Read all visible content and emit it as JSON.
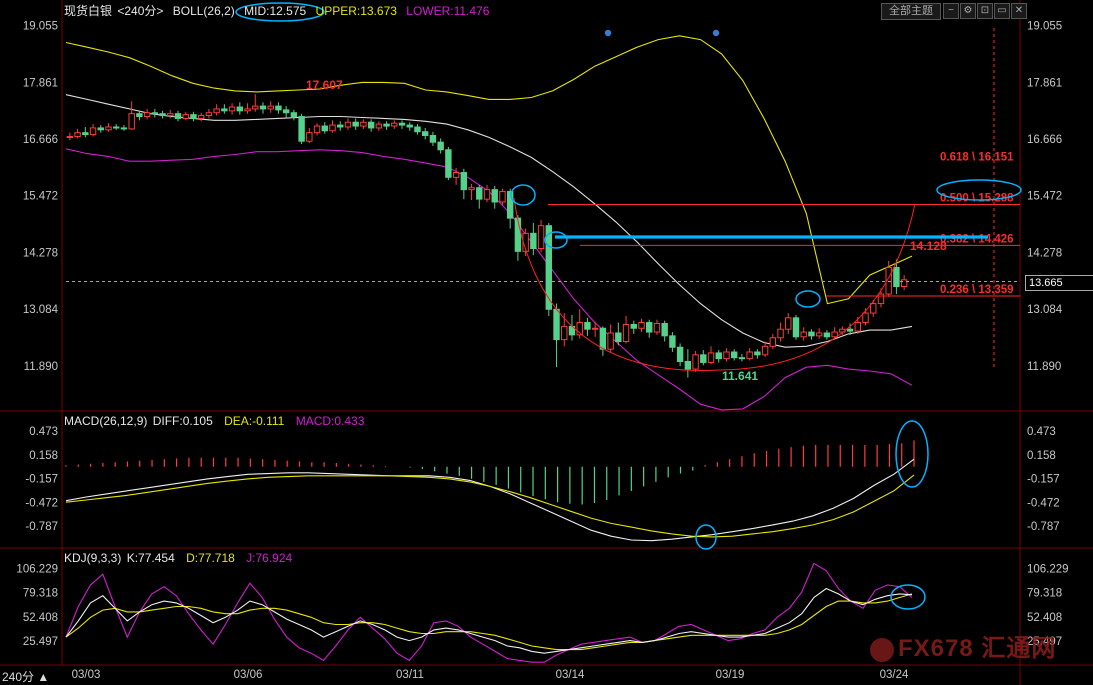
{
  "header": {
    "title": "现货白银",
    "period": "<240分>",
    "boll_label": "BOLL(26,2)",
    "mid": "MID:12.575",
    "upper": "UPPER:13.673",
    "lower": "LOWER:11.476",
    "theme_button": "全部主题",
    "period_tag": "240分 ▲"
  },
  "macd_header": {
    "label": "MACD(26,12,9)",
    "diff": "DIFF:0.105",
    "dea": "DEA:-0.111",
    "macd": "MACD:0.433"
  },
  "kdj_header": {
    "label": "KDJ(9,3,3)",
    "k": "K:77.454",
    "d": "D:77.718",
    "j": "J:76.924"
  },
  "watermark": "FX678 汇通网",
  "current_price": "13.665",
  "colors": {
    "up": "#ff3b3b",
    "down": "#54d28b",
    "mid": "#e0e0e0",
    "upper": "#e6e600",
    "lower": "#d21ed2",
    "annotation": "#00b4ff",
    "fib": "#ff2a2a"
  },
  "chart_data": [
    {
      "type": "candlestick",
      "name": "price",
      "y_ticks": [
        19.055,
        17.861,
        16.666,
        15.472,
        14.278,
        13.084,
        11.89
      ],
      "ylim": [
        11.0,
        19.3
      ],
      "x_ticks": [
        "03/03",
        "03/06",
        "03/11",
        "03/14",
        "03/19",
        "03/24"
      ],
      "candles": [
        [
          16.7,
          16.72,
          16.8,
          16.64
        ],
        [
          16.72,
          16.8,
          16.88,
          16.68
        ],
        [
          16.8,
          16.76,
          16.92,
          16.7
        ],
        [
          16.76,
          16.9,
          16.98,
          16.72
        ],
        [
          16.9,
          16.86,
          16.96,
          16.8
        ],
        [
          16.86,
          16.92,
          17.0,
          16.82
        ],
        [
          16.92,
          16.9,
          16.98,
          16.86
        ],
        [
          16.9,
          16.88,
          16.96,
          16.84
        ],
        [
          16.88,
          17.2,
          17.46,
          16.86
        ],
        [
          17.2,
          17.14,
          17.26,
          17.06
        ],
        [
          17.14,
          17.22,
          17.3,
          17.08
        ],
        [
          17.22,
          17.2,
          17.3,
          17.12
        ],
        [
          17.2,
          17.16,
          17.26,
          17.1
        ],
        [
          17.16,
          17.2,
          17.28,
          17.1
        ],
        [
          17.2,
          17.1,
          17.26,
          17.04
        ],
        [
          17.1,
          17.18,
          17.24,
          17.06
        ],
        [
          17.18,
          17.1,
          17.24,
          17.04
        ],
        [
          17.1,
          17.16,
          17.22,
          17.04
        ],
        [
          17.16,
          17.22,
          17.3,
          17.1
        ],
        [
          17.22,
          17.3,
          17.4,
          17.16
        ],
        [
          17.3,
          17.26,
          17.4,
          17.2
        ],
        [
          17.26,
          17.34,
          17.42,
          17.18
        ],
        [
          17.34,
          17.26,
          17.44,
          17.18
        ],
        [
          17.26,
          17.3,
          17.42,
          17.2
        ],
        [
          17.3,
          17.36,
          17.61,
          17.24
        ],
        [
          17.36,
          17.3,
          17.44,
          17.2
        ],
        [
          17.3,
          17.36,
          17.46,
          17.22
        ],
        [
          17.36,
          17.28,
          17.44,
          17.2
        ],
        [
          17.28,
          17.22,
          17.36,
          17.12
        ],
        [
          17.22,
          17.14,
          17.28,
          17.06
        ],
        [
          17.14,
          16.62,
          17.2,
          16.56
        ],
        [
          16.62,
          16.8,
          16.9,
          16.58
        ],
        [
          16.8,
          16.94,
          17.0,
          16.74
        ],
        [
          16.94,
          16.84,
          17.02,
          16.78
        ],
        [
          16.84,
          16.96,
          17.06,
          16.8
        ],
        [
          16.96,
          16.92,
          17.04,
          16.84
        ],
        [
          16.92,
          17.02,
          17.1,
          16.86
        ],
        [
          17.02,
          16.94,
          17.1,
          16.86
        ],
        [
          16.94,
          17.02,
          17.08,
          16.88
        ],
        [
          17.02,
          16.9,
          17.08,
          16.82
        ],
        [
          16.9,
          16.98,
          17.04,
          16.84
        ],
        [
          16.98,
          16.94,
          17.04,
          16.86
        ],
        [
          16.94,
          17.0,
          17.06,
          16.88
        ],
        [
          17.0,
          16.96,
          17.06,
          16.88
        ],
        [
          16.96,
          16.92,
          17.02,
          16.84
        ],
        [
          16.92,
          16.82,
          16.98,
          16.76
        ],
        [
          16.82,
          16.74,
          16.9,
          16.66
        ],
        [
          16.74,
          16.6,
          16.82,
          16.52
        ],
        [
          16.6,
          16.44,
          16.68,
          16.36
        ],
        [
          16.44,
          15.86,
          16.5,
          15.8
        ],
        [
          15.86,
          15.96,
          16.06,
          15.7
        ],
        [
          15.96,
          15.6,
          16.04,
          15.4
        ],
        [
          15.6,
          15.64,
          15.72,
          15.38
        ],
        [
          15.64,
          15.4,
          15.7,
          15.2
        ],
        [
          15.4,
          15.6,
          15.7,
          15.34
        ],
        [
          15.6,
          15.34,
          15.68,
          15.2
        ],
        [
          15.34,
          15.56,
          15.62,
          15.28
        ],
        [
          15.56,
          15.0,
          15.62,
          14.78
        ],
        [
          15.0,
          14.3,
          15.06,
          14.1
        ],
        [
          14.3,
          14.68,
          14.78,
          14.2
        ],
        [
          14.68,
          14.36,
          14.9,
          14.22
        ],
        [
          14.36,
          14.84,
          14.96,
          14.28
        ],
        [
          14.84,
          13.08,
          14.9,
          12.94
        ],
        [
          13.08,
          12.44,
          13.2,
          11.86
        ],
        [
          12.44,
          12.72,
          13.0,
          12.3
        ],
        [
          12.72,
          12.54,
          12.96,
          12.42
        ],
        [
          12.54,
          12.8,
          13.08,
          12.46
        ],
        [
          12.8,
          12.66,
          12.9,
          12.52
        ],
        [
          12.66,
          12.68,
          12.82,
          12.5
        ],
        [
          12.68,
          12.24,
          12.72,
          12.1
        ],
        [
          12.24,
          12.58,
          12.76,
          12.18
        ],
        [
          12.58,
          12.4,
          12.8,
          12.32
        ],
        [
          12.4,
          12.76,
          12.94,
          12.36
        ],
        [
          12.76,
          12.68,
          12.84,
          12.56
        ],
        [
          12.68,
          12.8,
          12.88,
          12.6
        ],
        [
          12.8,
          12.6,
          12.86,
          12.48
        ],
        [
          12.6,
          12.78,
          12.86,
          12.54
        ],
        [
          12.78,
          12.52,
          12.84,
          12.4
        ],
        [
          12.52,
          12.28,
          12.6,
          12.18
        ],
        [
          12.28,
          11.98,
          12.36,
          11.88
        ],
        [
          11.98,
          11.82,
          12.24,
          11.64
        ],
        [
          11.82,
          12.12,
          12.2,
          11.76
        ],
        [
          12.12,
          11.96,
          12.22,
          11.9
        ],
        [
          11.96,
          12.16,
          12.3,
          11.92
        ],
        [
          12.16,
          12.04,
          12.22,
          11.96
        ],
        [
          12.04,
          12.18,
          12.26,
          11.98
        ],
        [
          12.18,
          12.06,
          12.24,
          12.0
        ],
        [
          12.06,
          12.04,
          12.14,
          11.98
        ],
        [
          12.04,
          12.18,
          12.26,
          12.0
        ],
        [
          12.18,
          12.12,
          12.24,
          12.04
        ],
        [
          12.12,
          12.3,
          12.4,
          12.08
        ],
        [
          12.3,
          12.48,
          12.56,
          12.24
        ],
        [
          12.48,
          12.66,
          12.8,
          12.4
        ],
        [
          12.66,
          12.9,
          13.0,
          12.56
        ],
        [
          12.9,
          12.5,
          12.96,
          12.44
        ],
        [
          12.5,
          12.6,
          12.7,
          12.42
        ],
        [
          12.6,
          12.52,
          12.66,
          12.44
        ],
        [
          12.52,
          12.58,
          12.68,
          12.46
        ],
        [
          12.58,
          12.5,
          12.64,
          12.44
        ],
        [
          12.5,
          12.6,
          12.7,
          12.46
        ],
        [
          12.6,
          12.66,
          12.72,
          12.54
        ],
        [
          12.66,
          12.62,
          12.78,
          12.54
        ],
        [
          12.62,
          12.8,
          12.92,
          12.56
        ],
        [
          12.8,
          13.0,
          13.1,
          12.74
        ],
        [
          13.0,
          13.2,
          13.28,
          12.92
        ],
        [
          13.2,
          13.4,
          13.52,
          13.12
        ],
        [
          13.4,
          13.96,
          14.1,
          13.34
        ],
        [
          13.96,
          13.56,
          14.13,
          13.4
        ],
        [
          13.56,
          13.7,
          13.8,
          13.48
        ]
      ],
      "boll_upper": [
        18.7,
        18.6,
        18.5,
        18.38,
        18.2,
        18.0,
        17.84,
        17.74,
        17.68,
        17.66,
        17.68,
        17.7,
        17.72,
        17.8,
        17.86,
        17.86,
        17.84,
        17.7,
        17.66,
        17.58,
        17.5,
        17.5,
        17.54,
        17.68,
        17.92,
        18.2,
        18.4,
        18.6,
        18.76,
        18.84,
        18.76,
        18.46,
        17.9,
        17.1,
        16.2,
        15.1,
        13.2,
        13.3,
        13.8,
        14.0,
        14.2
      ],
      "boll_mid": [
        17.6,
        17.5,
        17.4,
        17.3,
        17.2,
        17.14,
        17.1,
        17.06,
        17.06,
        17.08,
        17.1,
        17.12,
        17.14,
        17.14,
        17.12,
        17.1,
        17.08,
        17.04,
        16.98,
        16.86,
        16.7,
        16.5,
        16.28,
        15.98,
        15.66,
        15.3,
        14.92,
        14.5,
        14.04,
        13.6,
        13.2,
        12.86,
        12.58,
        12.38,
        12.28,
        12.3,
        12.4,
        12.56,
        12.64,
        12.64,
        12.72
      ],
      "boll_lower": [
        16.46,
        16.36,
        16.3,
        16.2,
        16.2,
        16.22,
        16.24,
        16.3,
        16.34,
        16.4,
        16.4,
        16.42,
        16.44,
        16.42,
        16.38,
        16.3,
        16.24,
        16.16,
        16.08,
        15.86,
        15.56,
        15.1,
        14.5,
        13.9,
        13.3,
        12.8,
        12.4,
        12.0,
        11.7,
        11.4,
        11.08,
        10.96,
        10.98,
        11.24,
        11.64,
        11.86,
        11.9,
        11.82,
        11.78,
        11.72,
        11.48
      ],
      "labels": {
        "high": "17.607",
        "low": "11.641",
        "recent_high": "14.128",
        "fib": [
          "0.618 \\ 16.151",
          "0.500 \\ 15.288",
          "0.382 \\ 14.426",
          "0.236 \\ 13.359"
        ]
      },
      "fib_values": [
        16.151,
        15.288,
        14.426,
        13.359
      ],
      "dashed_price": 13.665
    },
    {
      "type": "macd",
      "y_ticks": [
        "0.473",
        "0.158",
        "-0.157",
        "-0.472",
        "-0.787"
      ],
      "y_values": [
        0.473,
        0.158,
        -0.157,
        -0.472,
        -0.787
      ],
      "ylim": [
        -1.05,
        0.62
      ],
      "hist": [
        0.02,
        0.03,
        0.04,
        0.05,
        0.06,
        0.07,
        0.08,
        0.09,
        0.1,
        0.11,
        0.12,
        0.12,
        0.12,
        0.12,
        0.12,
        0.11,
        0.1,
        0.09,
        0.08,
        0.07,
        0.06,
        0.06,
        0.05,
        0.04,
        0.03,
        0.02,
        0.01,
        0.0,
        -0.01,
        -0.03,
        -0.06,
        -0.09,
        -0.12,
        -0.16,
        -0.2,
        -0.24,
        -0.29,
        -0.34,
        -0.39,
        -0.43,
        -0.47,
        -0.49,
        -0.5,
        -0.48,
        -0.44,
        -0.38,
        -0.32,
        -0.26,
        -0.2,
        -0.14,
        -0.09,
        -0.05,
        0.02,
        0.06,
        0.1,
        0.14,
        0.18,
        0.21,
        0.24,
        0.26,
        0.28,
        0.29,
        0.29,
        0.29,
        0.29,
        0.29,
        0.29,
        0.3,
        0.31,
        0.35
      ],
      "diff": [
        -0.45,
        -0.4,
        -0.36,
        -0.32,
        -0.28,
        -0.24,
        -0.2,
        -0.16,
        -0.13,
        -0.1,
        -0.09,
        -0.08,
        -0.08,
        -0.09,
        -0.1,
        -0.11,
        -0.12,
        -0.12,
        -0.12,
        -0.14,
        -0.18,
        -0.26,
        -0.36,
        -0.48,
        -0.6,
        -0.72,
        -0.84,
        -0.92,
        -0.97,
        -0.98,
        -0.96,
        -0.93,
        -0.9,
        -0.86,
        -0.82,
        -0.77,
        -0.72,
        -0.65,
        -0.55,
        -0.42,
        -0.25,
        -0.1,
        0.1
      ],
      "dea": [
        -0.47,
        -0.44,
        -0.41,
        -0.38,
        -0.34,
        -0.3,
        -0.26,
        -0.22,
        -0.19,
        -0.16,
        -0.14,
        -0.13,
        -0.12,
        -0.12,
        -0.12,
        -0.12,
        -0.12,
        -0.13,
        -0.14,
        -0.16,
        -0.2,
        -0.26,
        -0.33,
        -0.41,
        -0.5,
        -0.59,
        -0.68,
        -0.75,
        -0.8,
        -0.85,
        -0.89,
        -0.92,
        -0.93,
        -0.92,
        -0.89,
        -0.86,
        -0.82,
        -0.77,
        -0.7,
        -0.6,
        -0.46,
        -0.32,
        -0.11
      ]
    },
    {
      "type": "kdj",
      "y_ticks": [
        "106.229",
        "79.318",
        "52.408",
        "25.497"
      ],
      "y_values": [
        106.229,
        79.318,
        52.408,
        25.497
      ],
      "ylim": [
        0,
        118
      ],
      "k": [
        30,
        48,
        68,
        76,
        62,
        48,
        58,
        66,
        70,
        68,
        62,
        54,
        46,
        52,
        60,
        70,
        66,
        58,
        50,
        44,
        38,
        30,
        36,
        42,
        48,
        44,
        38,
        30,
        26,
        30,
        38,
        40,
        38,
        34,
        30,
        26,
        20,
        18,
        14,
        12,
        14,
        16,
        18,
        20,
        22,
        24,
        26,
        24,
        26,
        30,
        34,
        36,
        34,
        32,
        30,
        30,
        32,
        34,
        40,
        46,
        56,
        74,
        84,
        78,
        70,
        66,
        72,
        76,
        78,
        77
      ],
      "d": [
        30,
        40,
        52,
        60,
        62,
        58,
        58,
        60,
        62,
        64,
        64,
        62,
        58,
        56,
        56,
        60,
        62,
        62,
        60,
        56,
        52,
        46,
        44,
        44,
        46,
        46,
        44,
        40,
        36,
        34,
        34,
        36,
        36,
        36,
        34,
        32,
        28,
        24,
        20,
        18,
        16,
        16,
        16,
        18,
        20,
        22,
        24,
        24,
        26,
        28,
        30,
        32,
        32,
        32,
        32,
        32,
        32,
        32,
        34,
        38,
        44,
        54,
        64,
        70,
        70,
        68,
        68,
        70,
        74,
        78
      ],
      "j": [
        30,
        64,
        88,
        100,
        64,
        30,
        58,
        78,
        86,
        76,
        56,
        38,
        22,
        44,
        68,
        90,
        74,
        50,
        30,
        18,
        12,
        4,
        20,
        38,
        52,
        40,
        28,
        12,
        4,
        20,
        46,
        48,
        42,
        30,
        22,
        14,
        6,
        4,
        2,
        2,
        10,
        16,
        22,
        24,
        26,
        28,
        30,
        24,
        26,
        34,
        42,
        44,
        38,
        32,
        26,
        28,
        34,
        38,
        52,
        62,
        80,
        112,
        104,
        84,
        70,
        62,
        82,
        88,
        86,
        74
      ]
    }
  ]
}
